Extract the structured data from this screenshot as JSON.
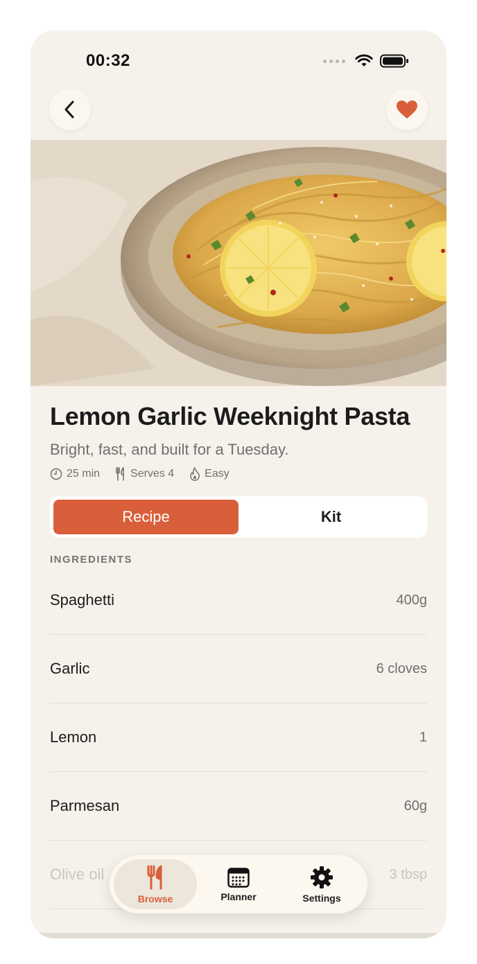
{
  "status": {
    "time": "00:32"
  },
  "colors": {
    "accent": "#d95f3b",
    "background": "#f6f2eb"
  },
  "header": {
    "back_icon": "chevron-left-icon",
    "favorite_icon": "heart-icon"
  },
  "recipe": {
    "title": "Lemon Garlic Weeknight Pasta",
    "subtitle": "Bright, fast, and built for a Tuesday.",
    "meta": {
      "time": "25 min",
      "serves": "Serves 4",
      "difficulty": "Easy"
    }
  },
  "tabs": {
    "recipe": "Recipe",
    "kit": "Kit",
    "selected": "Recipe"
  },
  "ingredients": {
    "label": "INGREDIENTS",
    "items": [
      {
        "name": "Spaghetti",
        "qty": "400g"
      },
      {
        "name": "Garlic",
        "qty": "6 cloves"
      },
      {
        "name": "Lemon",
        "qty": "1"
      },
      {
        "name": "Parmesan",
        "qty": "60g"
      },
      {
        "name": "Olive oil",
        "qty": "3 tbsp"
      }
    ]
  },
  "tabbar": {
    "items": [
      {
        "label": "Browse",
        "icon": "fork-knife-icon",
        "active": true
      },
      {
        "label": "Planner",
        "icon": "calendar-icon",
        "active": false
      },
      {
        "label": "Settings",
        "icon": "gear-icon",
        "active": false
      }
    ]
  }
}
